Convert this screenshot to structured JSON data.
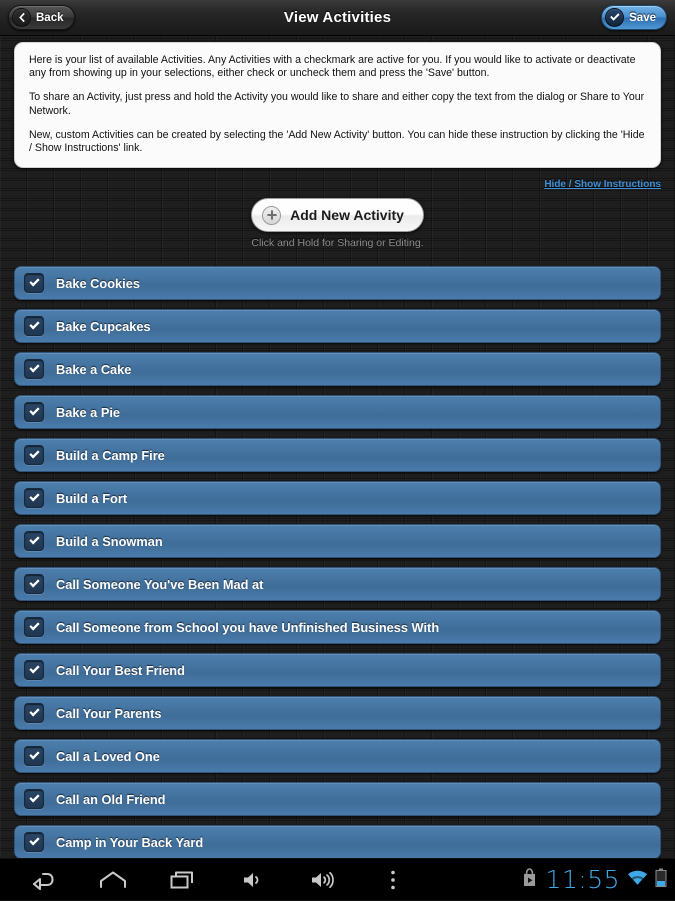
{
  "header": {
    "title": "View Activities",
    "back_label": "Back",
    "save_label": "Save"
  },
  "instructions": {
    "paragraphs": [
      "Here is your list of available Activities. Any Activities with a checkmark are active for you. If you would like to activate or deactivate any from showing up in your selections, either check or uncheck them and press the 'Save' button.",
      "To share an Activity, just press and hold the Activity you would like to share and either copy the text from the dialog or Share to Your Network.",
      "New, custom Activities can be created by selecting the 'Add New Activity' button. You can hide these instruction by clicking the 'Hide / Show Instructions' link."
    ],
    "toggle_link": "Hide / Show Instructions"
  },
  "add_section": {
    "button_label": "Add New Activity",
    "plus_icon": "plus-circle-icon",
    "subtitle": "Click and Hold for Sharing or Editing."
  },
  "activities": [
    {
      "label": "Bake Cookies",
      "checked": true
    },
    {
      "label": "Bake Cupcakes",
      "checked": true
    },
    {
      "label": "Bake a Cake",
      "checked": true
    },
    {
      "label": "Bake a Pie",
      "checked": true
    },
    {
      "label": "Build a Camp Fire",
      "checked": true
    },
    {
      "label": "Build a Fort",
      "checked": true
    },
    {
      "label": "Build a Snowman",
      "checked": true
    },
    {
      "label": "Call Someone You've Been Mad at",
      "checked": true
    },
    {
      "label": "Call Someone from School you have Unfinished Business With",
      "checked": true
    },
    {
      "label": "Call Your Best Friend",
      "checked": true
    },
    {
      "label": "Call Your Parents",
      "checked": true
    },
    {
      "label": "Call a Loved One",
      "checked": true
    },
    {
      "label": "Call an Old Friend",
      "checked": true
    },
    {
      "label": "Camp in Your Back Yard",
      "checked": true
    }
  ],
  "navbar": {
    "buttons": [
      "back-icon",
      "home-icon",
      "recents-icon",
      "volume-down-icon",
      "volume-up-icon",
      "overflow-menu-icon"
    ],
    "status": {
      "play-store-icon": "play-store-icon",
      "time": "11:55",
      "wifi-icon": "wifi-icon",
      "battery-icon": "battery-icon"
    }
  },
  "colors": {
    "row_blue": "#44739f",
    "accent_blue": "#3ea9e8",
    "link_blue": "#3f90d8",
    "background": "#1b1b1b"
  }
}
